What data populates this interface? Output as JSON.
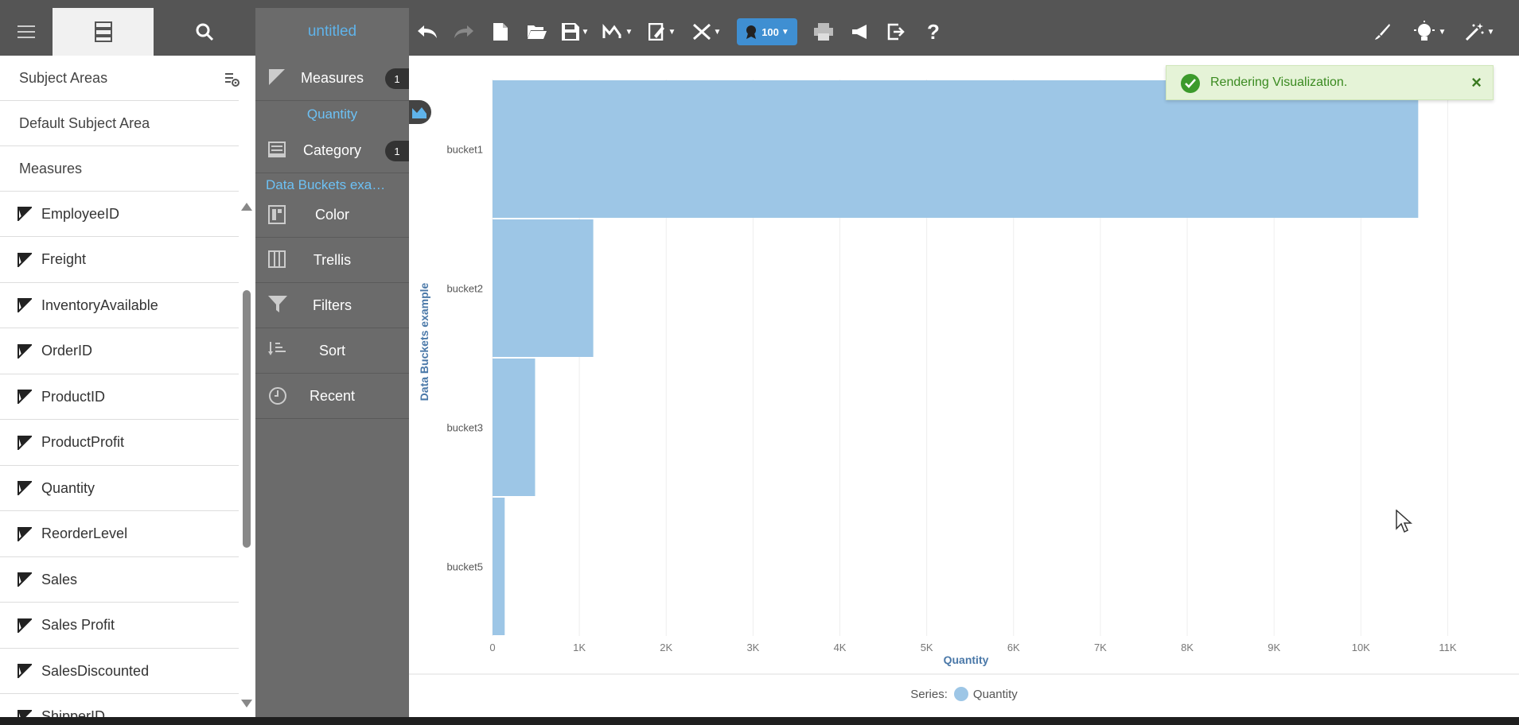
{
  "toolbar": {
    "title": "untitled",
    "zoom_badge": "100",
    "help_label": "?"
  },
  "left_panel": {
    "subject_areas_label": "Subject Areas",
    "default_subject_area": "Default Subject Area",
    "measures_label": "Measures",
    "items": [
      {
        "label": "EmployeeID"
      },
      {
        "label": "Freight"
      },
      {
        "label": "InventoryAvailable"
      },
      {
        "label": "OrderID"
      },
      {
        "label": "ProductID"
      },
      {
        "label": "ProductProfit"
      },
      {
        "label": "Quantity"
      },
      {
        "label": "ReorderLevel"
      },
      {
        "label": "Sales"
      },
      {
        "label": "Sales Profit"
      },
      {
        "label": "SalesDiscounted"
      },
      {
        "label": "ShipperID"
      }
    ]
  },
  "grammar": {
    "measures_label": "Measures",
    "measures_count": "1",
    "measures_value": "Quantity",
    "category_label": "Category",
    "category_count": "1",
    "category_value": "Data Buckets exa…",
    "color_label": "Color",
    "trellis_label": "Trellis",
    "filters_label": "Filters",
    "sort_label": "Sort",
    "recent_label": "Recent"
  },
  "toast": {
    "message": "Rendering Visualization.",
    "close_label": "×"
  },
  "legend": {
    "series_label": "Series:",
    "series_name": "Quantity",
    "color": "#9dc6e6"
  },
  "colors": {
    "bar": "#9dc6e6",
    "axis_title": "#4a78a8",
    "accent": "#5fb3ea"
  },
  "chart_data": {
    "type": "bar",
    "orientation": "horizontal",
    "categories": [
      "bucket1",
      "bucket2",
      "bucket3",
      "bucket5"
    ],
    "series": [
      {
        "name": "Quantity",
        "values": [
          10660,
          1160,
          490,
          140
        ]
      }
    ],
    "xlabel": "Quantity",
    "ylabel": "Data Buckets example",
    "xlim": [
      0,
      11500
    ],
    "xticks": [
      0,
      1000,
      2000,
      3000,
      4000,
      5000,
      6000,
      7000,
      8000,
      9000,
      10000,
      11000
    ],
    "xtick_labels": [
      "0",
      "1K",
      "2K",
      "3K",
      "4K",
      "5K",
      "6K",
      "7K",
      "8K",
      "9K",
      "10K",
      "11K"
    ],
    "grid": true
  }
}
